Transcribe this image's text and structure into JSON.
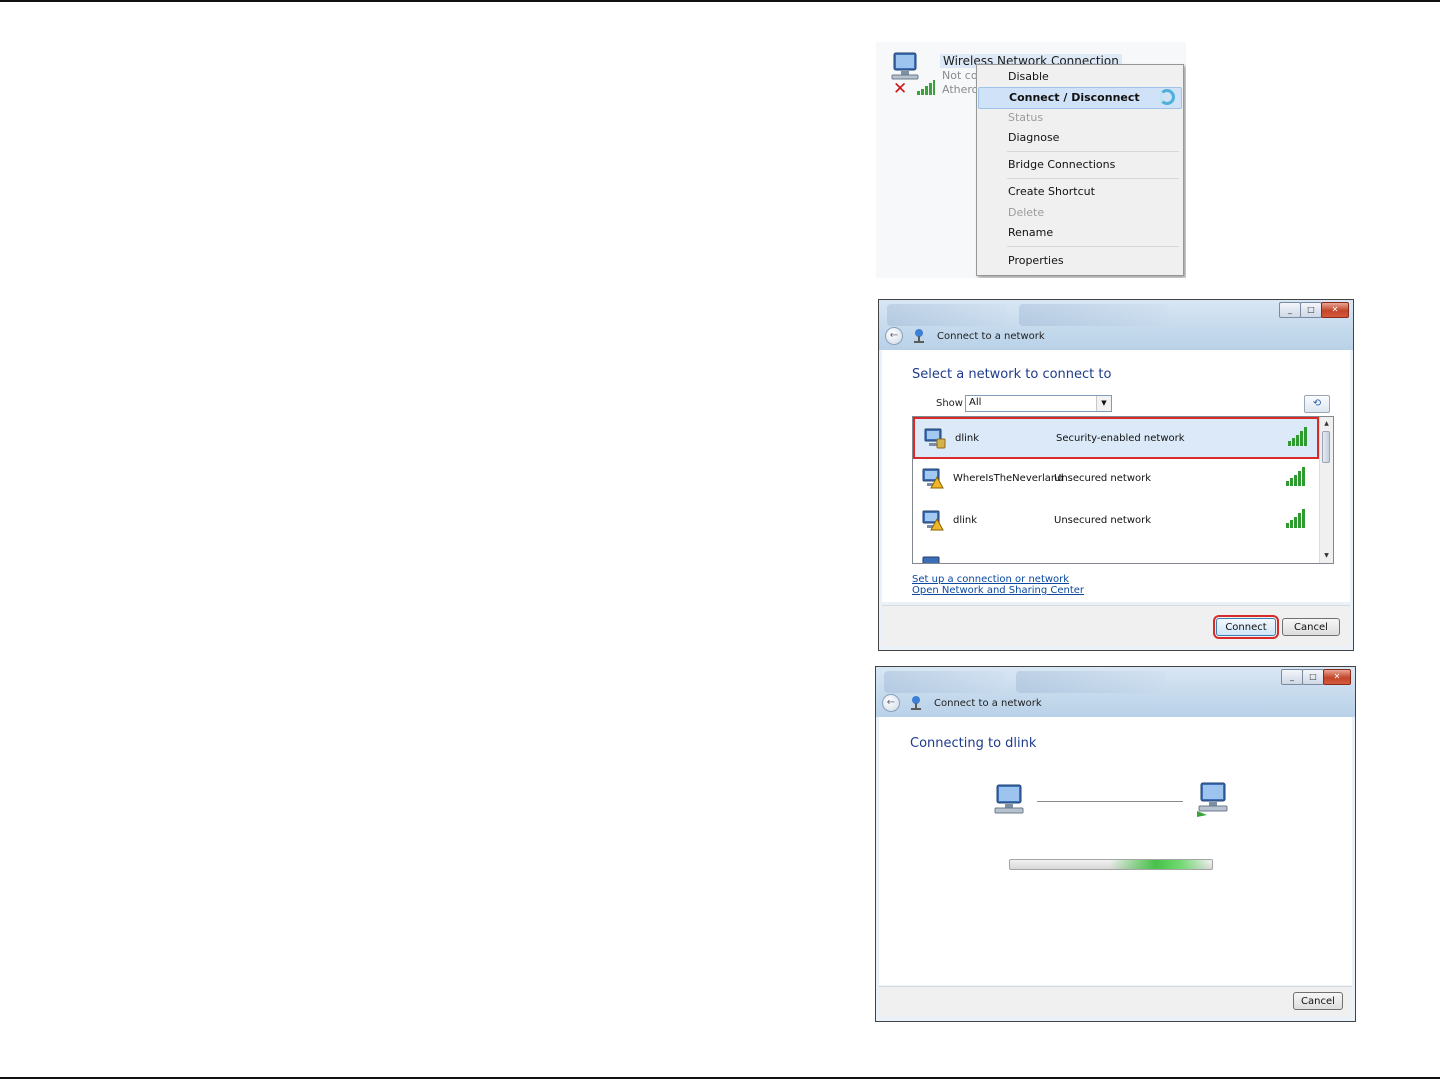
{
  "context_menu": {
    "connection_title": "Wireless Network Connection",
    "connection_status": "Not con",
    "connection_adapter": "Atheros",
    "items": [
      {
        "label": "Disable",
        "state": "normal"
      },
      {
        "label": "Connect / Disconnect",
        "state": "highlighted"
      },
      {
        "label": "Status",
        "state": "disabled"
      },
      {
        "label": "Diagnose",
        "state": "normal"
      },
      {
        "label": "Bridge Connections",
        "state": "normal"
      },
      {
        "label": "Create Shortcut",
        "state": "normal"
      },
      {
        "label": "Delete",
        "state": "disabled"
      },
      {
        "label": "Rename",
        "state": "normal"
      },
      {
        "label": "Properties",
        "state": "normal"
      }
    ]
  },
  "select_dialog": {
    "caption": "Connect to a network",
    "heading": "Select a network to connect to",
    "show_label": "Show",
    "show_value": "All",
    "networks": [
      {
        "name": "dlink",
        "security": "Security-enabled network",
        "selected": true
      },
      {
        "name": "WhereIsTheNeverland",
        "security": "Unsecured network",
        "selected": false
      },
      {
        "name": "dlink",
        "security": "Unsecured network",
        "selected": false
      }
    ],
    "links": [
      "Set up a connection or network",
      "Open Network and Sharing Center"
    ],
    "connect_button": "Connect",
    "cancel_button": "Cancel"
  },
  "connecting_dialog": {
    "caption": "Connect to a network",
    "heading": "Connecting to dlink",
    "cancel_button": "Cancel"
  },
  "colors": {
    "highlight_outline": "#d92a2a",
    "heading_blue": "#1f3c8c",
    "link_blue": "#0b49a0",
    "progress_green": "#48c14a"
  }
}
